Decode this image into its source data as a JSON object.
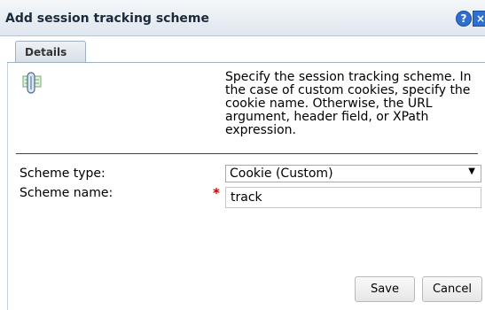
{
  "dialog": {
    "title": "Add session tracking scheme",
    "help_icon": "help-icon",
    "close_icon": "close-icon"
  },
  "tabs": [
    {
      "label": "Details"
    }
  ],
  "details": {
    "icon": "session-scheme-icon",
    "description": "Specify the session tracking scheme. In the case of custom cookies, specify the cookie name. Otherwise, the URL argument, header field, or XPath expression."
  },
  "form": {
    "scheme_type": {
      "label": "Scheme type:",
      "value": "Cookie (Custom)"
    },
    "scheme_name": {
      "label": "Scheme name:",
      "required_marker": "*",
      "value": "track"
    }
  },
  "buttons": {
    "save": "Save",
    "cancel": "Cancel"
  },
  "colors": {
    "accent": "#2f6fd1",
    "required": "#d00000",
    "title_text": "#1b2a3a"
  }
}
